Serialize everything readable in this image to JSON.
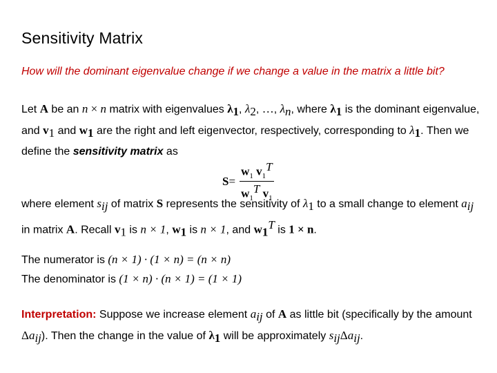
{
  "title": "Sensitivity Matrix",
  "question": "How will the dominant eigenvalue change if we change a value in the matrix a little bit?",
  "colors": {
    "accent": "#c00000",
    "text": "#000000",
    "background": "#ffffff"
  },
  "p1": {
    "t1": "Let ",
    "A": "A",
    "t2": " be an ",
    "n1": "n",
    "x1": " × ",
    "n2": "n",
    "t3": " matrix with eigenvalues ",
    "lam": "λ",
    "s1": "1",
    "s2": "2",
    "sn": "n",
    "comma": ", ",
    "dots": " … ",
    "t4": ", where ",
    "t5": " is the dominant eigenvalue, and ",
    "v": "v",
    "w": "w",
    "t6": " and ",
    "t7": " are the right and left eigenvector, respectively, corresponding to ",
    "t8": ". Then we define the ",
    "emph": "sensitivity matrix",
    "t9": " as"
  },
  "formula": {
    "lhs": "S",
    "eq": " = ",
    "w": "w",
    "v": "v",
    "sub": "1",
    "T": "T"
  },
  "p2": {
    "t1": "where element ",
    "s": "s",
    "ij": "ij",
    "t2": " of matrix ",
    "S": "S",
    "t3": " represents the sensitivity of ",
    "t4": " to a small change to element ",
    "a": "a",
    "t5": " in matrix ",
    "A": "A",
    "t6": ". Recall ",
    "t7": " is ",
    "dim1": "n × 1",
    "t8": ", ",
    "t9": " is ",
    "t10": ", and ",
    "t11": " is ",
    "dim2": "1 × n",
    "end": "."
  },
  "p3": {
    "num_label": "The numerator is ",
    "num_expr": "(n × 1) · (1 × n) = (n × n)",
    "den_label": "The denominator is ",
    "den_expr": "(1 × n) · (n × 1) = (1 × 1)"
  },
  "p4": {
    "label": "Interpretation:",
    "t1": " Suppose we increase element ",
    "t2": " of ",
    "t3": " as little bit (specifically by the amount ",
    "delta": "Δ",
    "t4": "). Then the change in the value of ",
    "t5": " will be approximately ",
    "end": "."
  }
}
